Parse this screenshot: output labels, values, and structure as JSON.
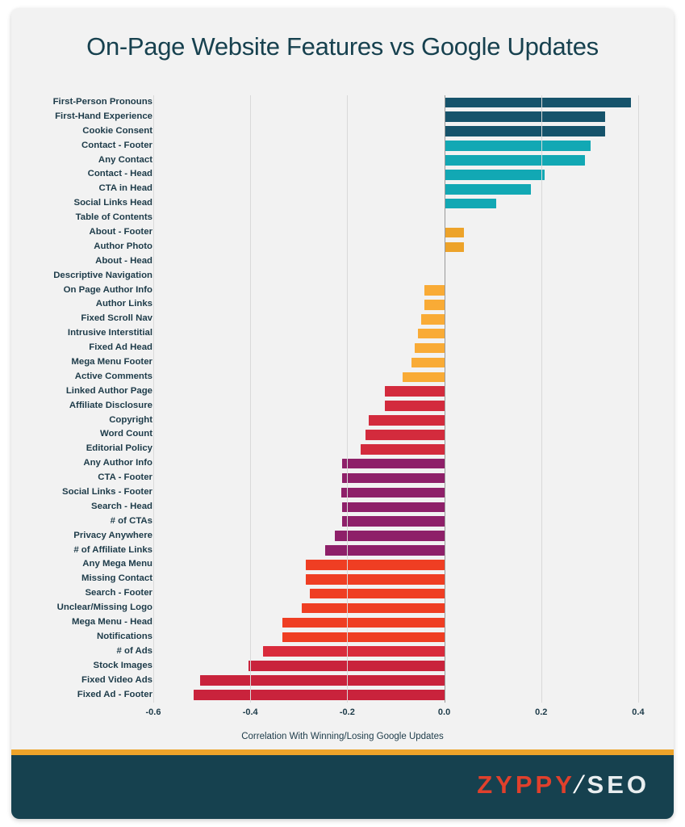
{
  "chart_data": {
    "type": "bar",
    "orientation": "horizontal",
    "title": "On-Page Website Features vs Google Updates",
    "xlabel": "Correlation With Winning/Losing Google Updates",
    "ylabel": "",
    "xlim": [
      -0.6,
      0.45
    ],
    "xticks": [
      -0.6,
      -0.4,
      -0.2,
      0.0,
      0.2,
      0.4
    ],
    "xticklabels": [
      "-0.6",
      "-0.4",
      "-0.2",
      "0.0",
      "0.2",
      "0.4"
    ],
    "grid": true,
    "legend": "none",
    "categories": [
      "First-Person Pronouns",
      "First-Hand Experience",
      "Cookie Consent",
      "Contact - Footer",
      "Any Contact",
      "Contact - Head",
      "CTA in Head",
      "Social Links Head",
      "Table of Contents",
      "About - Footer",
      "Author Photo",
      "About - Head",
      "Descriptive Navigation",
      "On Page Author Info",
      "Author Links",
      "Fixed Scroll Nav",
      "Intrusive Interstitial",
      "Fixed Ad Head",
      "Mega Menu Footer",
      "Active Comments",
      "Linked Author Page",
      "Affiliate Disclosure",
      "Copyright",
      "Word Count",
      "Editorial Policy",
      "Any Author Info",
      "CTA - Footer",
      "Social Links - Footer",
      "Search - Head",
      "# of CTAs",
      "Privacy Anywhere",
      "# of Affiliate Links",
      "Any Mega Menu",
      "Missing Contact",
      "Search - Footer",
      "Unclear/Missing Logo",
      "Mega Menu - Head",
      "Notifications",
      "# of Ads",
      "Stock Images",
      "Fixed Video Ads",
      "Fixed Ad - Footer"
    ],
    "values": [
      0.385,
      0.332,
      0.332,
      0.302,
      0.291,
      0.207,
      0.179,
      0.108,
      0.041,
      0.041,
      0.041,
      0.0,
      0.0,
      -0.041,
      -0.041,
      -0.048,
      -0.055,
      -0.061,
      -0.068,
      -0.086,
      -0.122,
      -0.122,
      -0.155,
      -0.162,
      -0.172,
      -0.211,
      -0.211,
      -0.213,
      -0.211,
      -0.21,
      -0.225,
      -0.245,
      -0.286,
      -0.286,
      -0.278,
      -0.294,
      -0.334,
      -0.334,
      -0.374,
      -0.404,
      -0.504,
      -0.516
    ],
    "colors": [
      "#16536b",
      "#16536b",
      "#16536b",
      "#12a8b4",
      "#12a8b4",
      "#12a8b4",
      "#12a8b4",
      "#12a8b4",
      "#edа32a",
      "#eda32a",
      "#eda32a",
      "#eda32a",
      "#eda32a",
      "#f9ab36",
      "#f9ab36",
      "#f9ab36",
      "#f9ab36",
      "#f9ab36",
      "#f9ab36",
      "#f9ab36",
      "#d32b3d",
      "#d32b3d",
      "#d32b3d",
      "#d32b3d",
      "#d32b3d",
      "#8e2069",
      "#8e2069",
      "#8e2069",
      "#8e2069",
      "#8e2069",
      "#8e2069",
      "#8e2069",
      "#ef3e23",
      "#ef3e23",
      "#ef3e23",
      "#ef3e23",
      "#ef3e23",
      "#ef3e23",
      "#d92b3c",
      "#c9233c",
      "#c9233c",
      "#c9233c"
    ],
    "bar_color_groups": [
      {
        "name": "dark-teal",
        "hex": "#16536b"
      },
      {
        "name": "cyan",
        "hex": "#12a8b4"
      },
      {
        "name": "amber",
        "hex": "#f0a32c"
      },
      {
        "name": "crimson",
        "hex": "#d32b3d"
      },
      {
        "name": "magenta",
        "hex": "#8e2069"
      },
      {
        "name": "orange-red",
        "hex": "#ef3e23"
      },
      {
        "name": "deep-red",
        "hex": "#c9233c"
      }
    ]
  },
  "footer": {
    "logo_primary": "ZYPPY",
    "logo_slash": "/",
    "logo_secondary": "SEO",
    "accent_color": "#eda32a",
    "background_color": "#16414f"
  }
}
